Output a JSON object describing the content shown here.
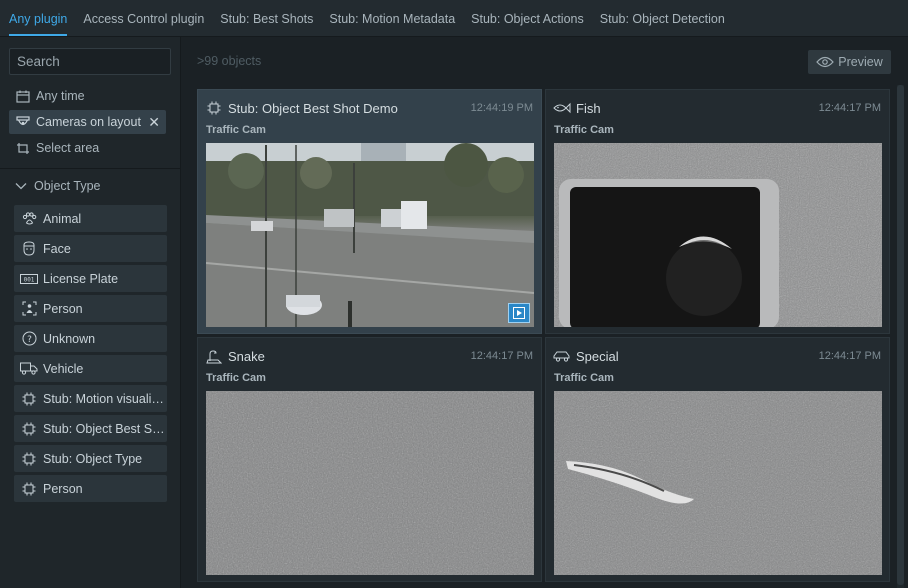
{
  "tabs": [
    {
      "label": "Any plugin",
      "active": true
    },
    {
      "label": "Access Control plugin"
    },
    {
      "label": "Stub: Best Shots"
    },
    {
      "label": "Stub: Motion Metadata"
    },
    {
      "label": "Stub: Object Actions"
    },
    {
      "label": "Stub: Object Detection"
    }
  ],
  "sidebar": {
    "search_placeholder": "Search",
    "any_time": "Any time",
    "cameras": "Cameras on layout",
    "select_area": "Select area",
    "object_type": "Object Type",
    "objects": [
      {
        "label": "Animal",
        "icon": "paw-icon"
      },
      {
        "label": "Face",
        "icon": "face-icon"
      },
      {
        "label": "License Plate",
        "icon": "license-plate-icon"
      },
      {
        "label": "Person",
        "icon": "person-icon"
      },
      {
        "label": "Unknown",
        "icon": "question-icon"
      },
      {
        "label": "Vehicle",
        "icon": "truck-icon"
      },
      {
        "label": "Stub: Motion visualization",
        "icon": "chip-icon"
      },
      {
        "label": "Stub: Object Best Shot",
        "icon": "chip-icon"
      },
      {
        "label": "Stub: Object Type",
        "icon": "chip-icon"
      },
      {
        "label": "Person",
        "icon": "chip-icon"
      }
    ]
  },
  "main": {
    "count": ">99 objects",
    "preview": "Preview",
    "tiles": [
      {
        "title": "Stub: Object Best Shot Demo",
        "time": "12:44:19 PM",
        "camera": "Traffic Cam",
        "icon": "chip-icon",
        "selected": true
      },
      {
        "title": "Fish",
        "time": "12:44:17 PM",
        "camera": "Traffic Cam",
        "icon": "fish-icon"
      },
      {
        "title": "Snake",
        "time": "12:44:17 PM",
        "camera": "Traffic Cam",
        "icon": "snake-icon"
      },
      {
        "title": "Special",
        "time": "12:44:17 PM",
        "camera": "Traffic Cam",
        "icon": "car-icon"
      }
    ]
  },
  "colors": {
    "accent": "#3fa9e8",
    "panel": "#1f262a",
    "tile": "#232b30",
    "selected_tile": "#33414b"
  }
}
